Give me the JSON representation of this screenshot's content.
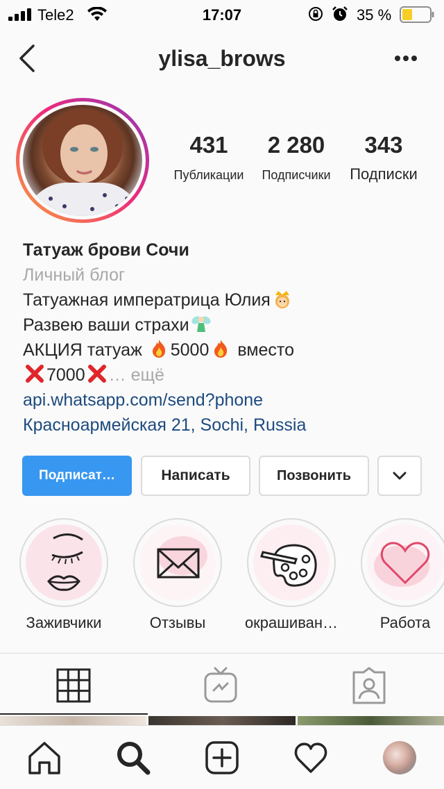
{
  "status_bar": {
    "carrier": "Tele2",
    "time": "17:07",
    "battery_percent": "35 %",
    "battery_level": 0.35,
    "icons": [
      "signal-icon",
      "wifi-icon",
      "orientation-lock-icon",
      "alarm-icon",
      "battery-icon"
    ]
  },
  "header": {
    "username": "ylisa_brows",
    "back_icon": "chevron-left-icon",
    "more_icon": "more-dots-icon"
  },
  "profile": {
    "stats": [
      {
        "value": "431",
        "label": "Публикации"
      },
      {
        "value": "2 280",
        "label": "Подписчики"
      },
      {
        "value": "343",
        "label": "Подписки"
      }
    ],
    "name": "Татуаж брови Сочи",
    "category": "Личный блог",
    "bio_lines": [
      {
        "text": "Татуажная императрица Юлия",
        "emoji": "crown-princess"
      },
      {
        "text": "Развею ваши страхи",
        "emoji": "fairy"
      },
      {
        "text_a": "АКЦИЯ татуаж ",
        "text_b": "5000",
        "text_c": " вместо"
      },
      {
        "text": "7000",
        "more": "… ещё"
      }
    ],
    "link": "api.whatsapp.com/send?phone",
    "address": "Красноармейская 21, Sochi, Russia"
  },
  "actions": {
    "follow": "Подписат…",
    "message": "Написать",
    "call": "Позвонить",
    "dropdown_icon": "chevron-down-icon"
  },
  "highlights": [
    {
      "label": "Заживчики",
      "icon": "eyelash-lips-icon"
    },
    {
      "label": "Отзывы",
      "icon": "envelope-icon"
    },
    {
      "label": "окрашиван…",
      "icon": "palette-icon"
    },
    {
      "label": "Работа",
      "icon": "heart-icon"
    }
  ],
  "tabs": [
    {
      "name": "grid",
      "icon": "grid-icon",
      "active": true
    },
    {
      "name": "igtv",
      "icon": "igtv-icon",
      "active": false
    },
    {
      "name": "tagged",
      "icon": "tagged-person-icon",
      "active": false
    }
  ],
  "bottom_nav": [
    "home-icon",
    "search-icon",
    "add-post-icon",
    "activity-heart-icon",
    "profile-avatar"
  ],
  "colors": {
    "accent_blue": "#3897f0",
    "link_blue": "#1d4a7f",
    "muted_gray": "#a8a8a8",
    "border": "#dbdbdb",
    "text": "#262626"
  }
}
